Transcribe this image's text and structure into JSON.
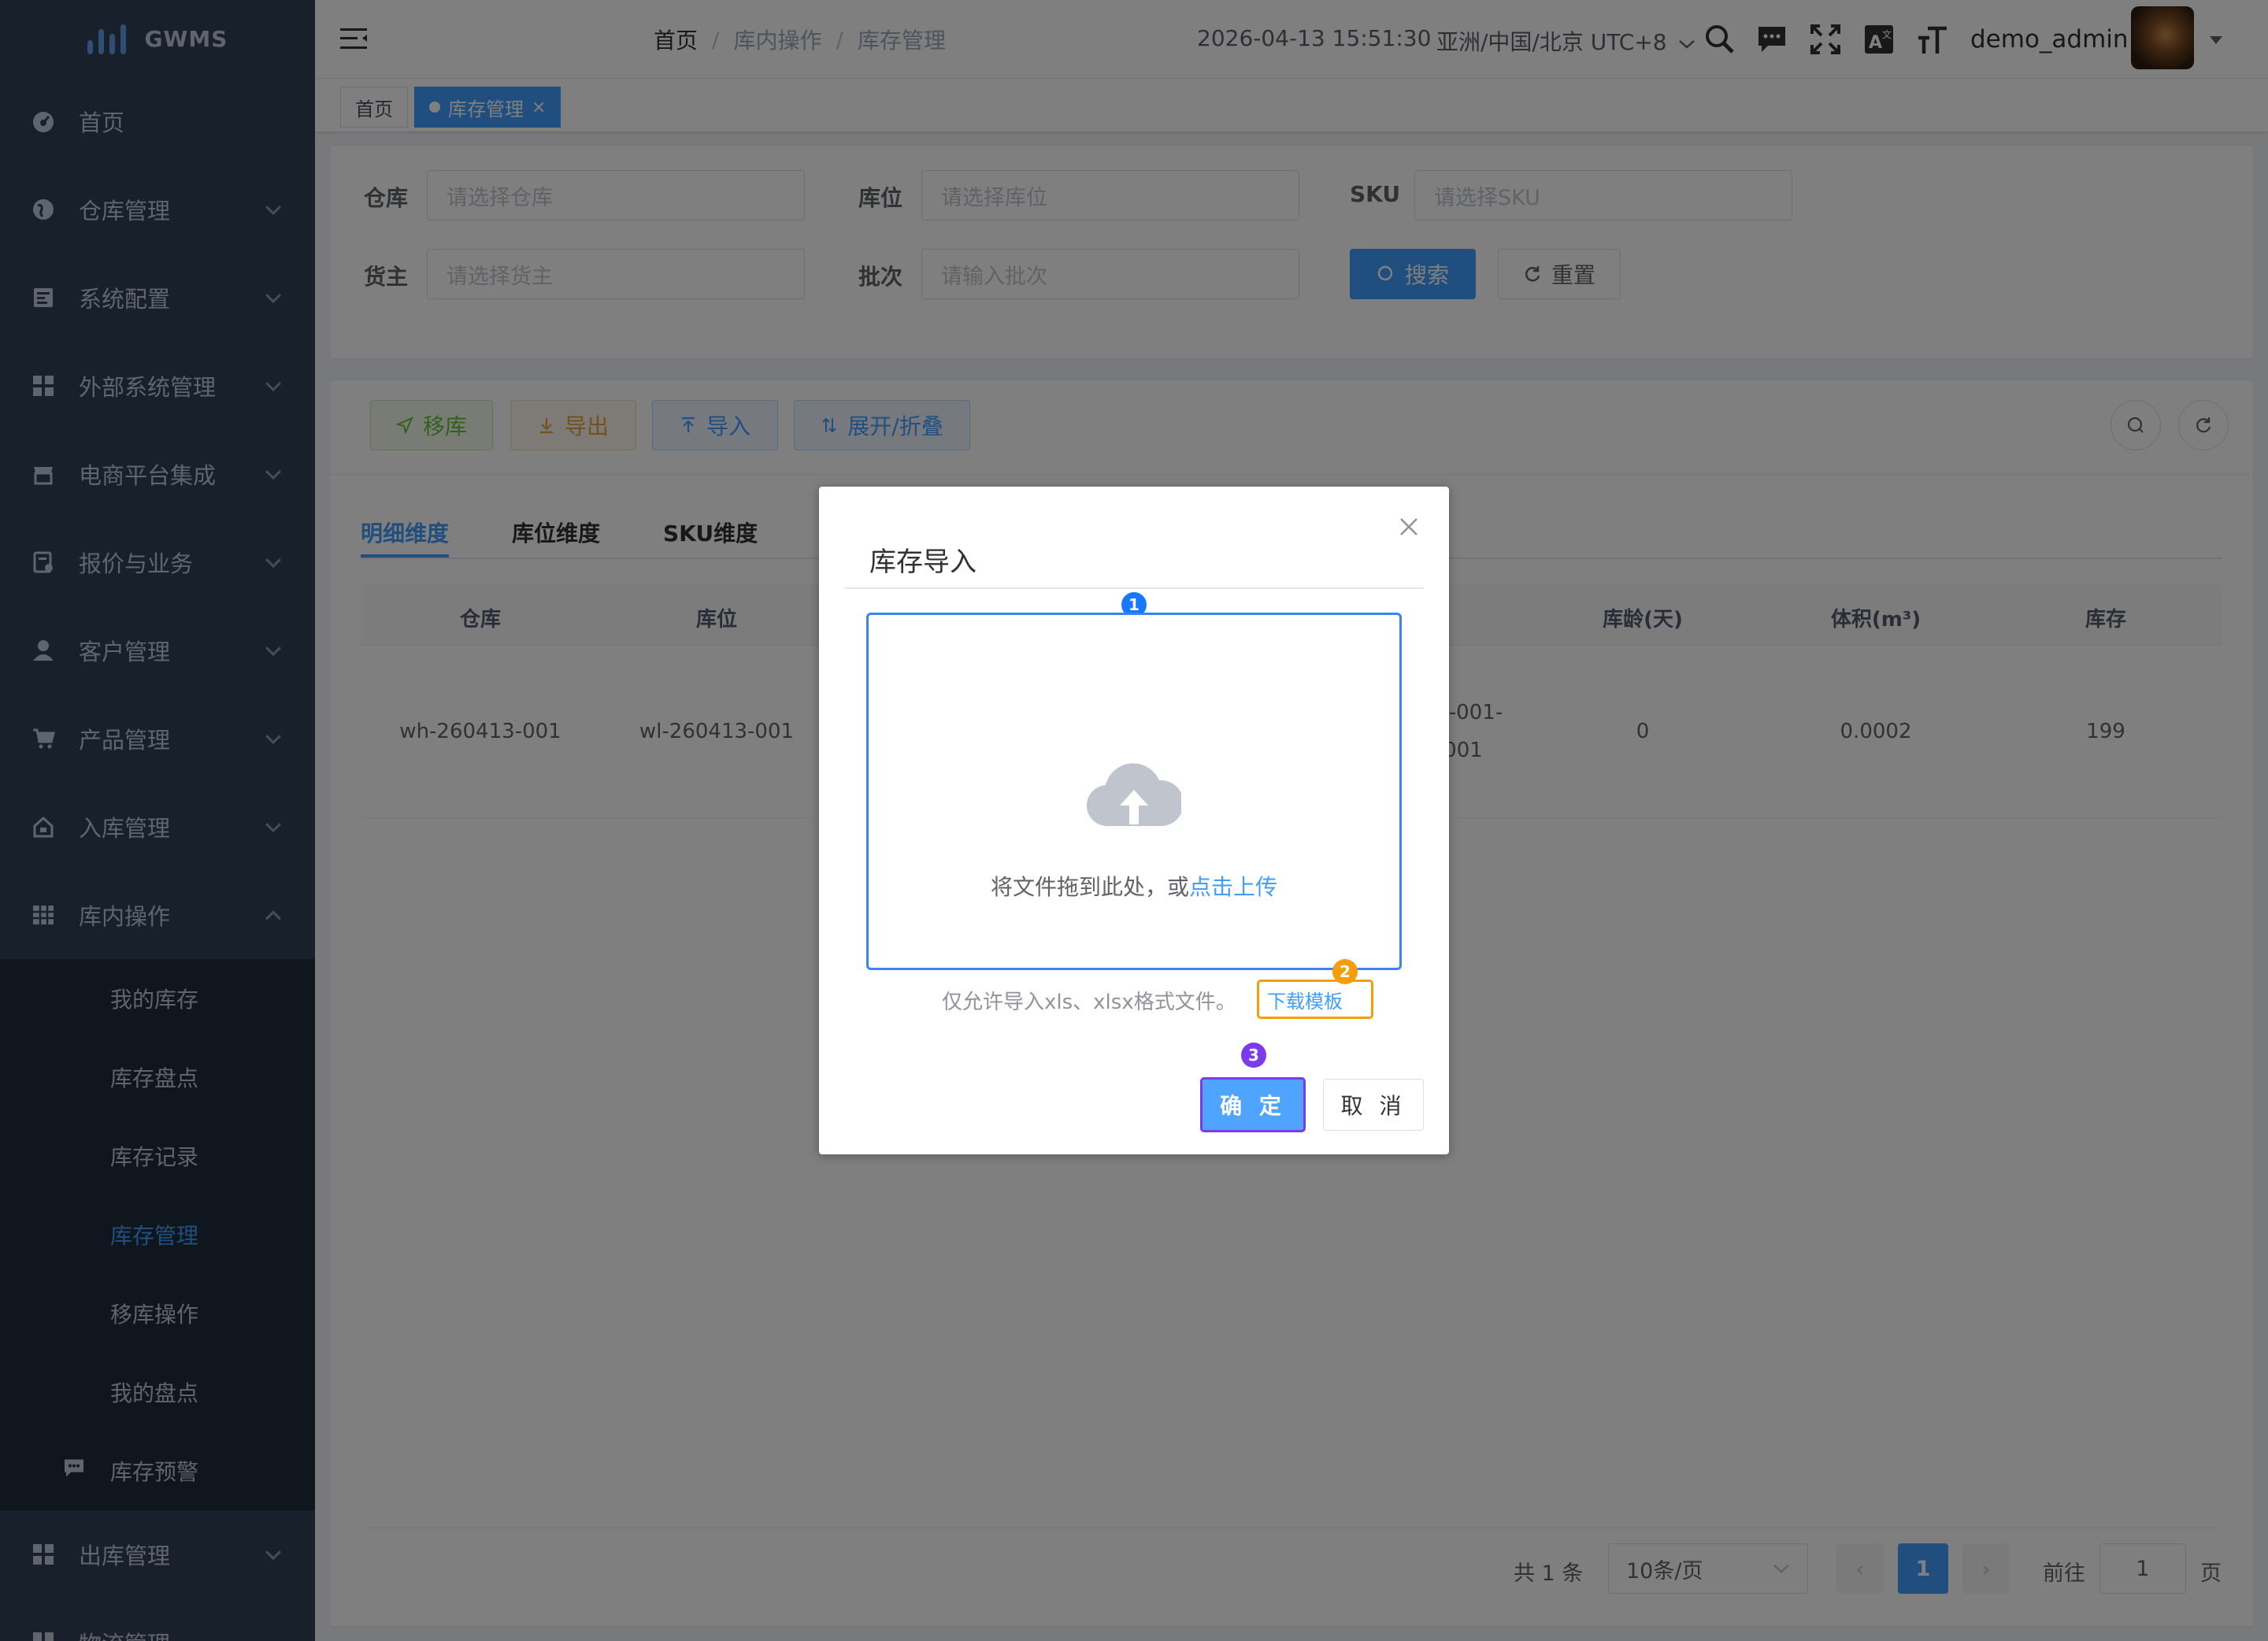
{
  "app": {
    "name": "GWMS"
  },
  "sidebar": {
    "items": [
      {
        "label": "首页",
        "icon": "dashboard-icon"
      },
      {
        "label": "仓库管理",
        "icon": "globe-icon"
      },
      {
        "label": "系统配置",
        "icon": "config-icon"
      },
      {
        "label": "外部系统管理",
        "icon": "grid-icon"
      },
      {
        "label": "电商平台集成",
        "icon": "store-icon"
      },
      {
        "label": "报价与业务",
        "icon": "quote-icon"
      },
      {
        "label": "客户管理",
        "icon": "user-icon"
      },
      {
        "label": "产品管理",
        "icon": "cart-icon"
      },
      {
        "label": "入库管理",
        "icon": "home-icon"
      },
      {
        "label": "库内操作",
        "icon": "table-icon"
      }
    ],
    "subitems": [
      "我的库存",
      "库存盘点",
      "库存记录",
      "库存管理",
      "移库操作",
      "我的盘点",
      "库存预警"
    ],
    "after": [
      {
        "label": "出库管理",
        "icon": "grid-icon"
      },
      {
        "label": "物流管理",
        "icon": "grid-icon"
      }
    ]
  },
  "header": {
    "breadcrumb": [
      "首页",
      "库内操作",
      "库存管理"
    ],
    "datetime": "2026-04-13 15:51:30",
    "timezone": "亚洲/中国/北京 UTC+8",
    "username": "demo_admin"
  },
  "tags": {
    "home": "首页",
    "current": "库存管理"
  },
  "filters": {
    "warehouse": {
      "label": "仓库",
      "placeholder": "请选择仓库"
    },
    "location": {
      "label": "库位",
      "placeholder": "请选择库位"
    },
    "sku": {
      "label": "SKU",
      "placeholder": "请选择SKU"
    },
    "owner": {
      "label": "货主",
      "placeholder": "请选择货主"
    },
    "batch": {
      "label": "批次",
      "placeholder": "请输入批次"
    },
    "search_label": "搜索",
    "reset_label": "重置"
  },
  "toolbar": {
    "move": "移库",
    "export": "导出",
    "import": "导入",
    "expand": "展开/折叠"
  },
  "tabs": [
    "明细维度",
    "库位维度",
    "SKU维度"
  ],
  "table": {
    "headers": {
      "warehouse": "仓库",
      "location": "库位",
      "age": "库龄(天)",
      "volume": "体积(m³)",
      "stock": "库存"
    },
    "row": {
      "warehouse": "wh-260413-001",
      "location": "wl-260413-001",
      "partial1": "-001-",
      "partial2": "001",
      "age": "0",
      "volume": "0.0002",
      "stock": "199"
    }
  },
  "pagination": {
    "total": "共 1 条",
    "size": "10条/页",
    "page": "1",
    "goto": "前往",
    "goto_value": "1",
    "unit": "页"
  },
  "dialog": {
    "title": "库存导入",
    "drop_text": "将文件拖到此处，或",
    "drop_link": "点击上传",
    "tip": "仅允许导入xls、xlsx格式文件。",
    "template_link": "下载模板",
    "ok": "确 定",
    "cancel": "取 消",
    "badges": [
      "1",
      "2",
      "3"
    ],
    "badge_colors": [
      "#1677ff",
      "#f59e0b",
      "#7c3aed"
    ]
  }
}
